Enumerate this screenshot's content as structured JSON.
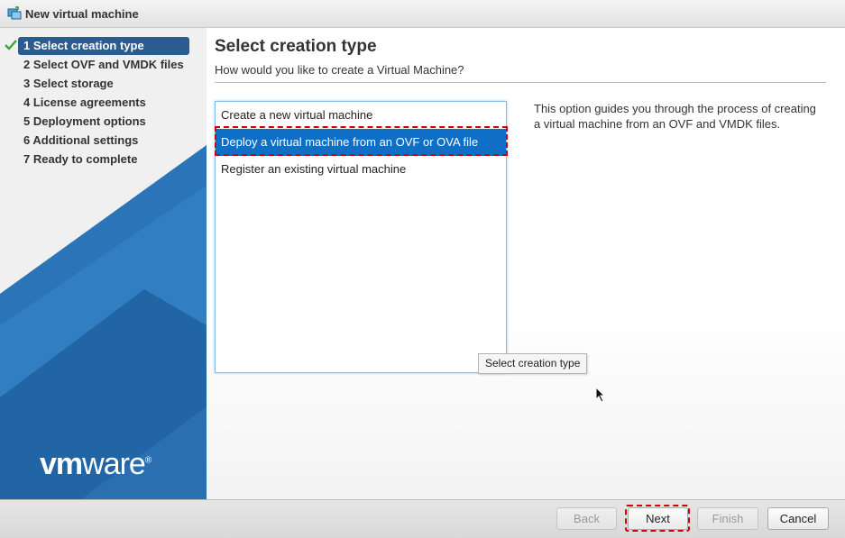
{
  "window": {
    "title": "New virtual machine",
    "icon": "vm-icon"
  },
  "sidebar": {
    "steps": [
      {
        "label": "1 Select creation type",
        "active": true,
        "completed": true
      },
      {
        "label": "2 Select OVF and VMDK files",
        "active": false
      },
      {
        "label": "3 Select storage",
        "active": false
      },
      {
        "label": "4 License agreements",
        "active": false
      },
      {
        "label": "5 Deployment options",
        "active": false
      },
      {
        "label": "6 Additional settings",
        "active": false
      },
      {
        "label": "7 Ready to complete",
        "active": false
      }
    ],
    "logo": {
      "vm": "vm",
      "ware": "ware",
      "registered": "®"
    }
  },
  "main": {
    "title": "Select creation type",
    "subtitle": "How would you like to create a Virtual Machine?",
    "options": [
      {
        "label": "Create a new virtual machine",
        "selected": false
      },
      {
        "label": "Deploy a virtual machine from an OVF or OVA file",
        "selected": true
      },
      {
        "label": "Register an existing virtual machine",
        "selected": false
      }
    ],
    "description": "This option guides you through the process of creating a virtual machine from an OVF and VMDK files.",
    "tooltip": "Select creation type"
  },
  "footer": {
    "back_label": "Back",
    "next_label": "Next",
    "finish_label": "Finish",
    "cancel_label": "Cancel"
  },
  "colors": {
    "active_step": "#2c5c8f",
    "selected_option": "#0f6fc6",
    "highlight": "#d10000",
    "sidebar_art": "#2b74b8"
  }
}
